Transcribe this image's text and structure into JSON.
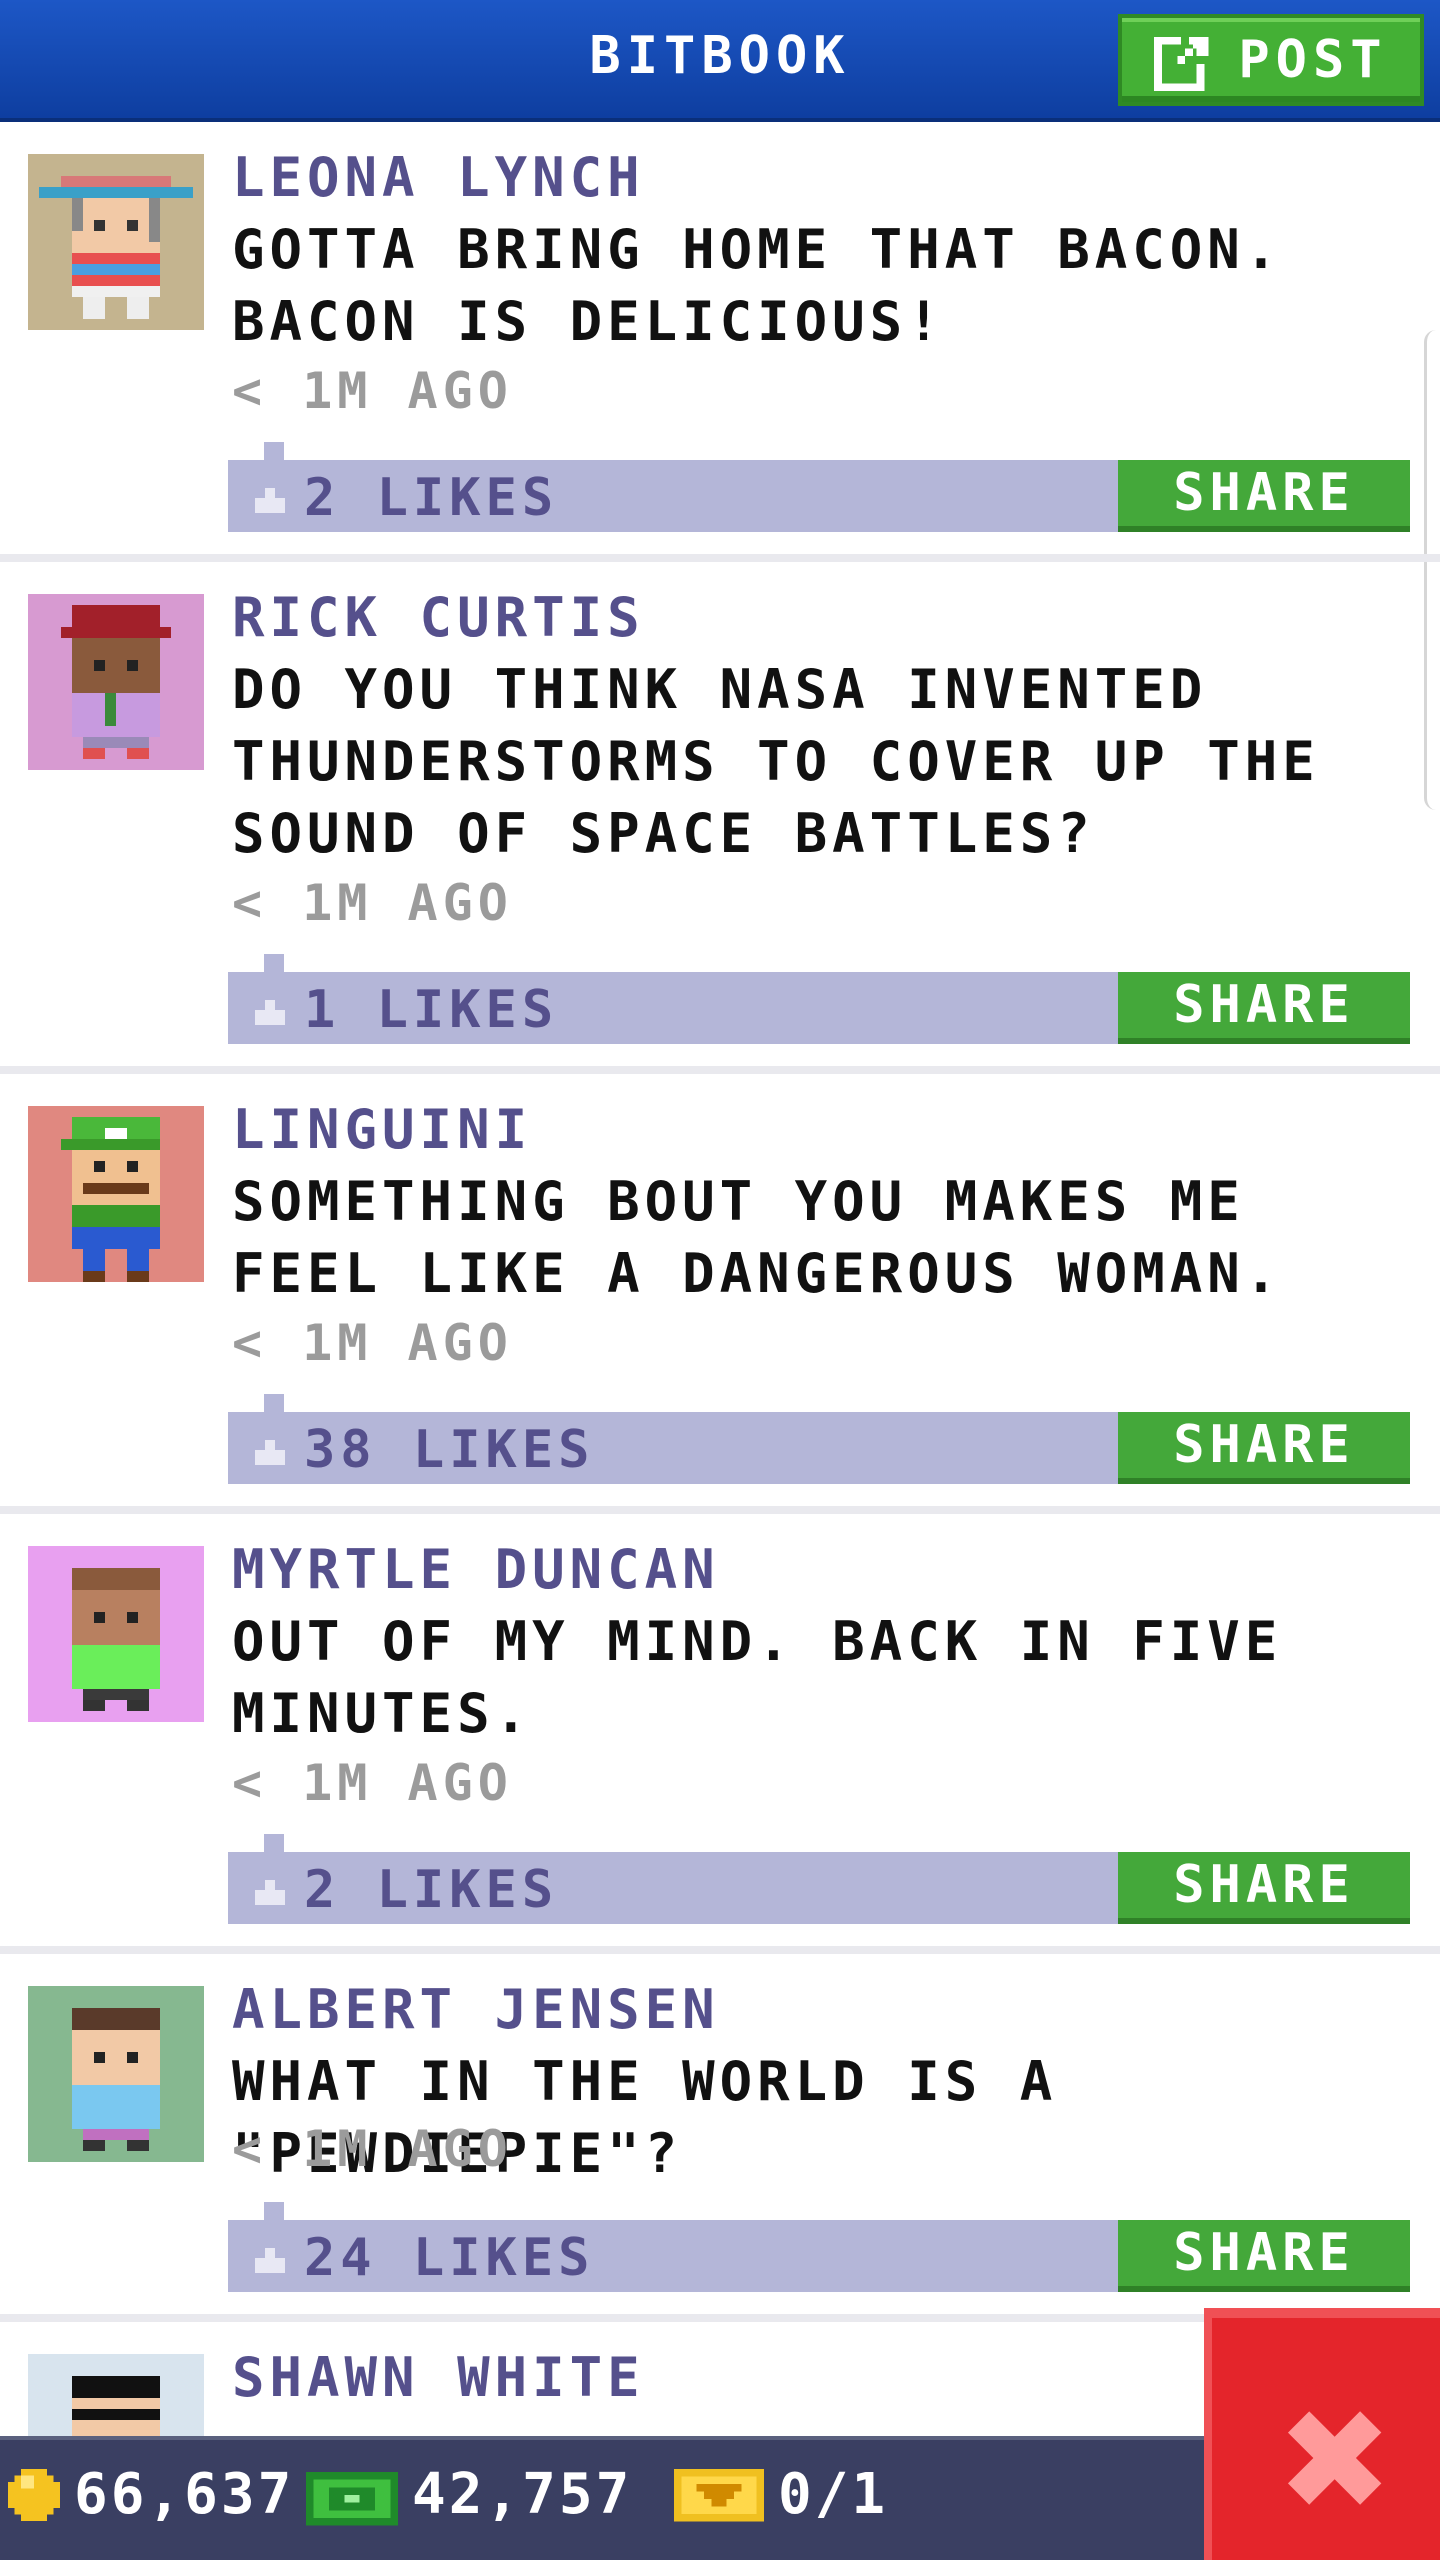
{
  "header": {
    "title": "BITBOOK",
    "post_label": "POST"
  },
  "posts": [
    {
      "name": "LEONA LYNCH",
      "text": "GOTTA BRING HOME THAT BACON. BACON IS DELICIOUS!",
      "time": "< 1M AGO",
      "likes": "2 LIKES",
      "share": "SHARE"
    },
    {
      "name": "RICK CURTIS",
      "text": "DO YOU THINK NASA INVENTED THUNDERSTORMS TO COVER UP THE SOUND OF SPACE BATTLES?",
      "time": "< 1M AGO",
      "likes": "1 LIKES",
      "share": "SHARE"
    },
    {
      "name": "LINGUINI",
      "text": "SOMETHING BOUT YOU MAKES ME FEEL LIKE A DANGEROUS WOMAN.",
      "time": "< 1M AGO",
      "likes": "38 LIKES",
      "share": "SHARE"
    },
    {
      "name": "MYRTLE DUNCAN",
      "text": "OUT OF MY MIND. BACK IN FIVE MINUTES.",
      "time": "< 1M AGO",
      "likes": "2 LIKES",
      "share": "SHARE"
    },
    {
      "name": "ALBERT JENSEN",
      "text": "WHAT IN THE WORLD IS A \"PEWDIEPIE\"?",
      "time": "< 1M AGO",
      "likes": "24 LIKES",
      "share": "SHARE"
    },
    {
      "name": "SHAWN WHITE"
    }
  ],
  "footer": {
    "coins": "66,637",
    "bux": "42,757",
    "tickets": "0/1"
  },
  "colors": {
    "header": "#1d57c6",
    "accent_green": "#44a83a",
    "bar": "#b4b6d8",
    "name": "#55508c",
    "close": "#e4252b"
  },
  "icons": [
    "edit-icon",
    "thumbs-up-icon",
    "coin-icon",
    "bux-icon",
    "ticket-icon",
    "close-icon"
  ]
}
